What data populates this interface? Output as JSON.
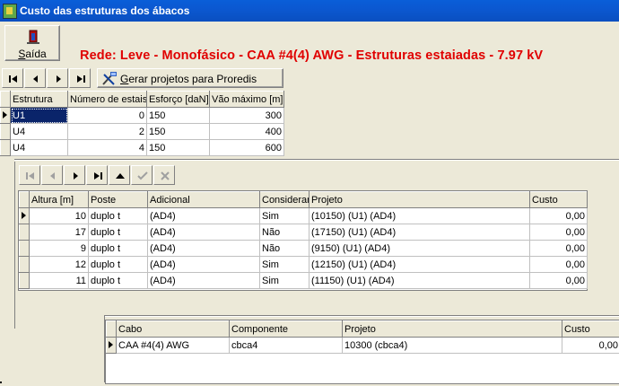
{
  "window": {
    "title": "Custo das estruturas dos ábacos"
  },
  "toolbar": {
    "exit_label": "Saída",
    "exit_accel": "S",
    "exit_rest": "aída",
    "gerar_label": "Gerar projetos para Proredis",
    "gerar_accel": "G",
    "gerar_rest": "erar projetos para Proredis"
  },
  "heading": "Rede: Leve - Monofásico - CAA #4(4) AWG - Estruturas estaiadas - 7.97 kV",
  "estruturas": {
    "headers": [
      "Estrutura",
      "Número de estais",
      "Esforço [daN]",
      "Vão máximo [m]"
    ],
    "rows": [
      [
        "U1",
        "0",
        "150",
        "300"
      ],
      [
        "U4",
        "2",
        "150",
        "400"
      ],
      [
        "U4",
        "4",
        "150",
        "600"
      ]
    ]
  },
  "alturas": {
    "headers": [
      "Altura [m]",
      "Poste",
      "Adicional",
      "Considerar",
      "Projeto",
      "Custo"
    ],
    "rows": [
      [
        "10",
        "duplo t",
        "(AD4)",
        "Sim",
        "(10150) (U1) (AD4)",
        "0,00"
      ],
      [
        "17",
        "duplo t",
        "(AD4)",
        "Não",
        "(17150) (U1) (AD4)",
        "0,00"
      ],
      [
        "9",
        "duplo t",
        "(AD4)",
        "Não",
        "(9150) (U1) (AD4)",
        "0,00"
      ],
      [
        "12",
        "duplo t",
        "(AD4)",
        "Sim",
        "(12150) (U1) (AD4)",
        "0,00"
      ],
      [
        "11",
        "duplo t",
        "(AD4)",
        "Sim",
        "(11150) (U1) (AD4)",
        "0,00"
      ]
    ]
  },
  "cabos": {
    "headers": [
      "Cabo",
      "Componente",
      "Projeto",
      "Custo"
    ],
    "rows": [
      [
        "CAA #4(4) AWG",
        "cbca4",
        "10300 (cbca4)",
        "0,00"
      ]
    ]
  },
  "icons": [
    "app-icon",
    "exit-door-icon",
    "first-record-icon",
    "prior-record-icon",
    "next-record-icon",
    "last-record-icon",
    "insert-icon",
    "post-icon",
    "cancel-icon",
    "proredis-tools-icon"
  ]
}
